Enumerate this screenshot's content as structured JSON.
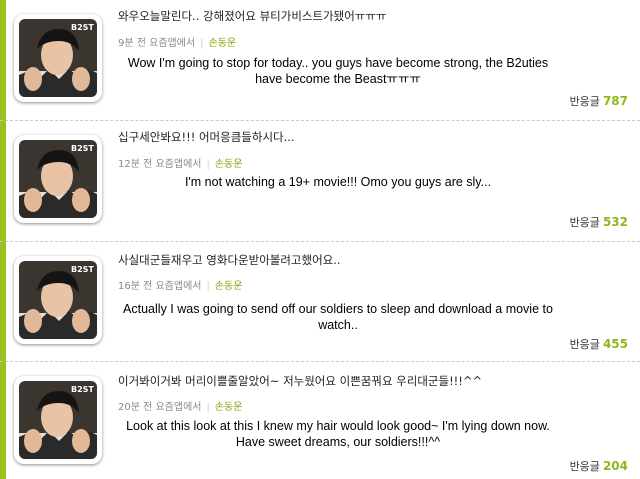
{
  "theme": {
    "accent": "#9cc11e",
    "author_color": "#85aa13",
    "count_color": "#8fb71b"
  },
  "posts": [
    {
      "ko_text": "와우오늘말린다.. 강해졌어요 뷰티가비스트가됐어ㅠㅠㅠ",
      "time": "9분 전 요즘앱에서",
      "author": "손동운",
      "translation": "Wow I'm going to stop for today.. you guys have become strong, the B2uties have become the Beastㅠㅠㅠ",
      "replies_label": "반응글",
      "replies_count": "787",
      "avatar_logo": "B2ST",
      "avatar_icon": "selfie-photo"
    },
    {
      "ko_text": "십구세안봐요!!! 어머응큼들하시다...",
      "time": "12분 전 요즘앱에서",
      "author": "손동운",
      "translation": "I'm not watching a 19+ movie!!! Omo you guys are sly...",
      "replies_label": "반응글",
      "replies_count": "532",
      "avatar_logo": "B2ST",
      "avatar_icon": "selfie-photo"
    },
    {
      "ko_text": "사실대군들재우고 영화다운받아볼려고했어요..",
      "time": "16분 전 요즘앱에서",
      "author": "손동운",
      "translation": "Actually I was going to send off our soldiers to sleep and download a movie to watch..",
      "replies_label": "반응글",
      "replies_count": "455",
      "avatar_logo": "B2ST",
      "avatar_icon": "selfie-photo"
    },
    {
      "ko_text": "이거봐이거봐 머리이쁠줄알았어~ 저누웠어요 이쁜꿈꿔요 우리대군들!!!^^",
      "time": "20분 전 요즘앱에서",
      "author": "손동운",
      "translation": "Look at this look at this I knew my hair would look good~ I'm lying down now. Have sweet dreams, our soldiers!!!^^",
      "replies_label": "반응글",
      "replies_count": "204",
      "avatar_logo": "B2ST",
      "avatar_icon": "selfie-photo"
    }
  ]
}
